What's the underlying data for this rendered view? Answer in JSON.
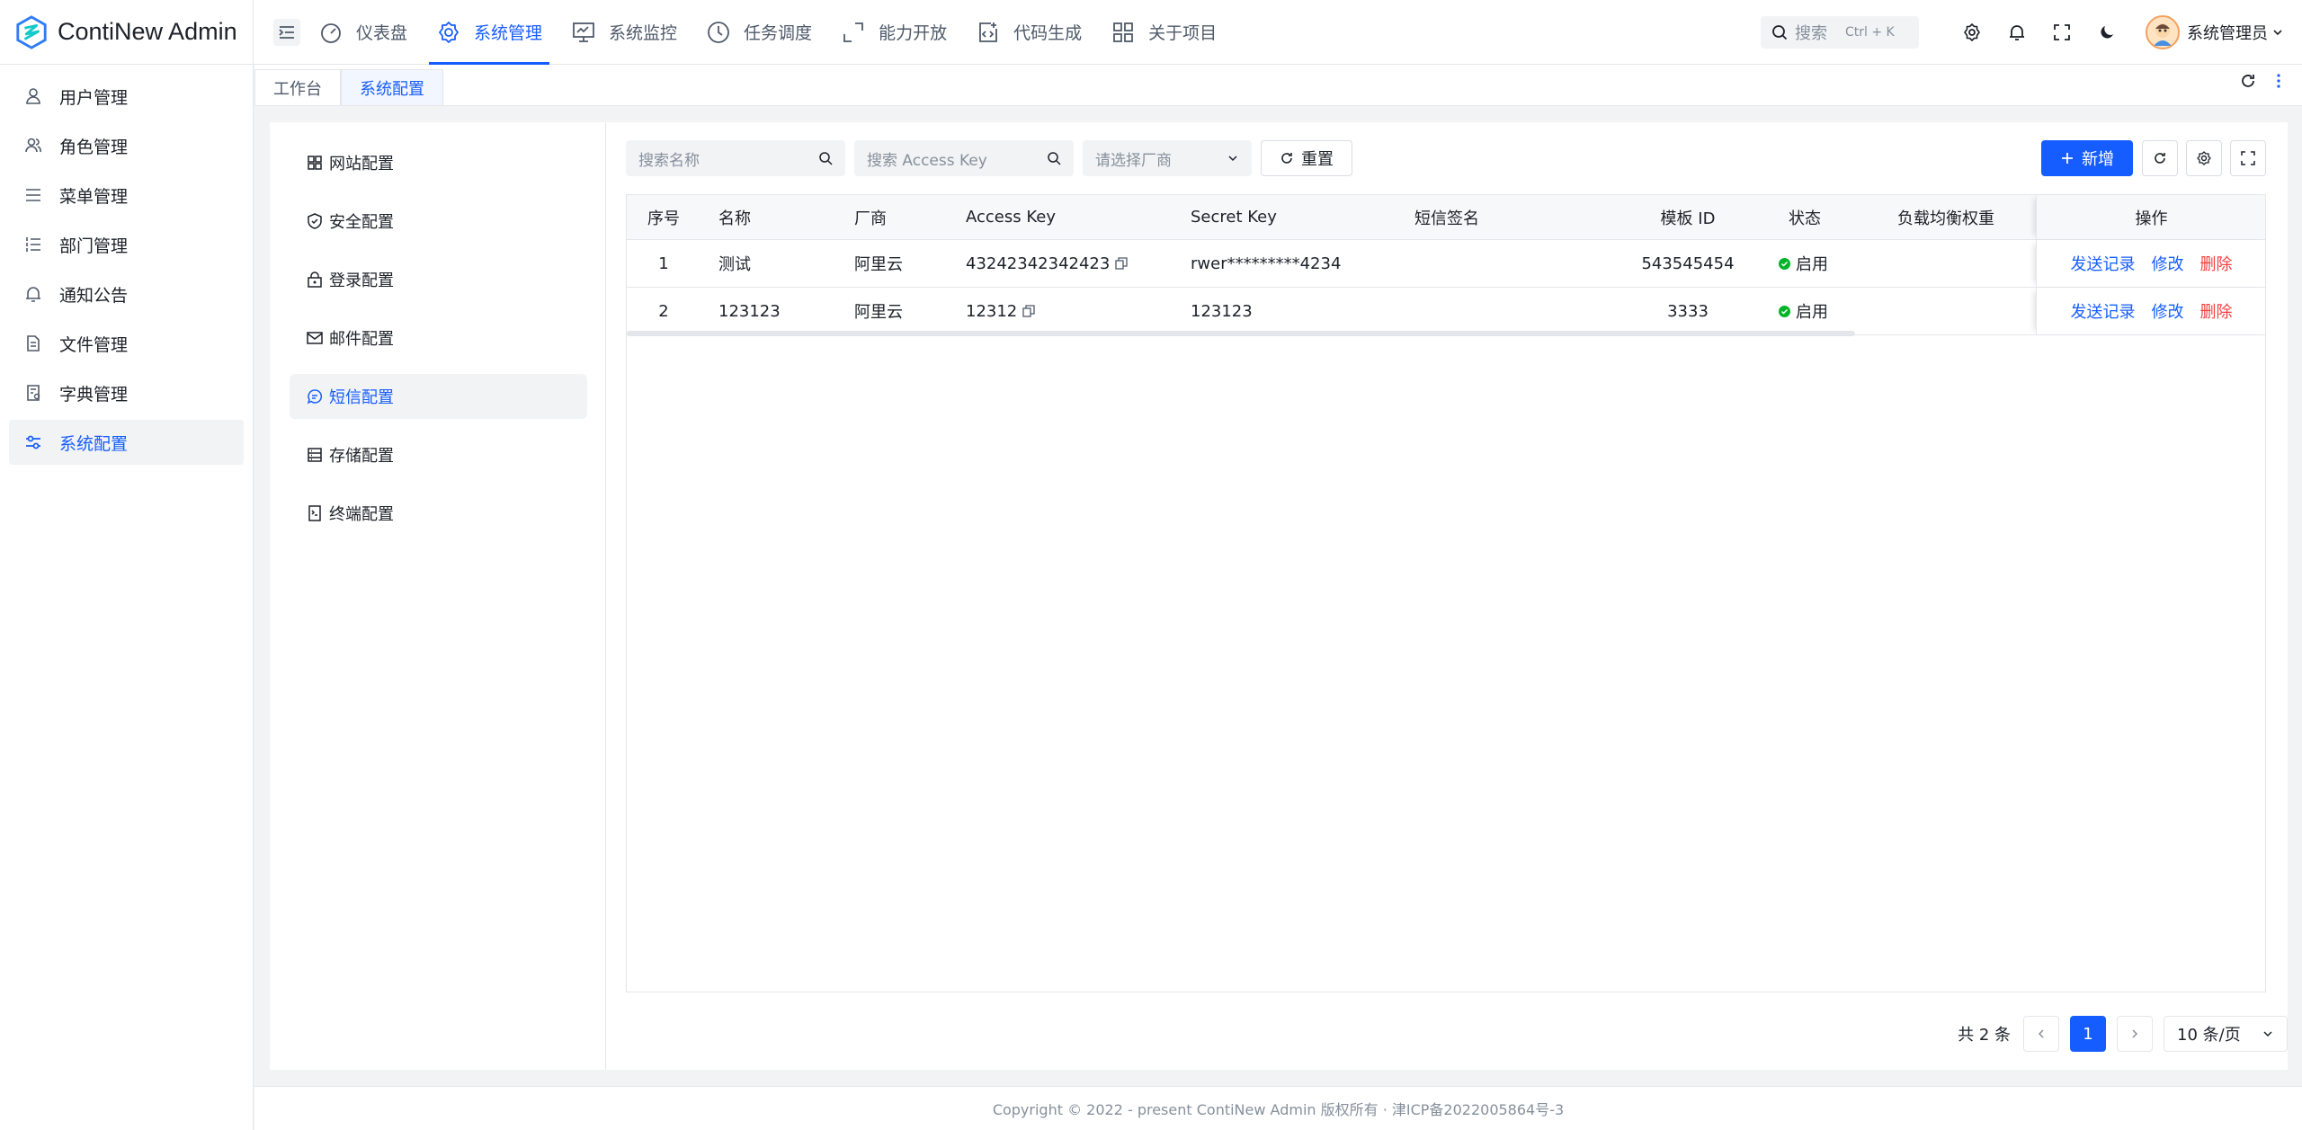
{
  "app": {
    "title": "ContiNew Admin"
  },
  "topnav": [
    {
      "label": "仪表盘",
      "icon": "dashboard-icon"
    },
    {
      "label": "系统管理",
      "icon": "gear-icon",
      "active": true
    },
    {
      "label": "系统监控",
      "icon": "monitor-icon"
    },
    {
      "label": "任务调度",
      "icon": "clock-icon"
    },
    {
      "label": "能力开放",
      "icon": "expand-icon"
    },
    {
      "label": "代码生成",
      "icon": "code-file-icon"
    },
    {
      "label": "关于项目",
      "icon": "grid-icon"
    }
  ],
  "header": {
    "search_placeholder": "搜索",
    "search_shortcut": "Ctrl + K",
    "user_name": "系统管理员"
  },
  "sidebar": [
    {
      "label": "用户管理",
      "icon": "user-icon"
    },
    {
      "label": "角色管理",
      "icon": "users-icon"
    },
    {
      "label": "菜单管理",
      "icon": "menu-list-icon"
    },
    {
      "label": "部门管理",
      "icon": "ordered-list-icon"
    },
    {
      "label": "通知公告",
      "icon": "bell-icon"
    },
    {
      "label": "文件管理",
      "icon": "file-icon"
    },
    {
      "label": "字典管理",
      "icon": "dictionary-icon"
    },
    {
      "label": "系统配置",
      "icon": "sliders-icon",
      "active": true
    }
  ],
  "tabs": [
    {
      "label": "工作台"
    },
    {
      "label": "系统配置",
      "active": true
    }
  ],
  "subnav": [
    {
      "label": "网站配置",
      "icon": "apps-icon"
    },
    {
      "label": "安全配置",
      "icon": "shield-check-icon"
    },
    {
      "label": "登录配置",
      "icon": "lock-icon"
    },
    {
      "label": "邮件配置",
      "icon": "mail-icon"
    },
    {
      "label": "短信配置",
      "icon": "message-icon",
      "active": true
    },
    {
      "label": "存储配置",
      "icon": "storage-icon"
    },
    {
      "label": "终端配置",
      "icon": "terminal-icon"
    }
  ],
  "toolbar": {
    "search_name_placeholder": "搜索名称",
    "search_key_placeholder": "搜索 Access Key",
    "vendor_placeholder": "请选择厂商",
    "reset_label": "重置",
    "add_label": "新增"
  },
  "table": {
    "columns": [
      "序号",
      "名称",
      "厂商",
      "Access Key",
      "Secret Key",
      "短信签名",
      "模板 ID",
      "状态",
      "负载均衡权重",
      "操作"
    ],
    "rows": [
      {
        "index": "1",
        "name": "测试",
        "vendor": "阿里云",
        "access_key": "43242342342423",
        "secret_key": "rwer*********4234",
        "signature": "",
        "template_id": "543545454",
        "status": "启用",
        "weight": ""
      },
      {
        "index": "2",
        "name": "123123",
        "vendor": "阿里云",
        "access_key": "12312",
        "secret_key": "123123",
        "signature": "",
        "template_id": "3333",
        "status": "启用",
        "weight": ""
      }
    ],
    "actions": {
      "records": "发送记录",
      "edit": "修改",
      "delete": "删除"
    }
  },
  "pagination": {
    "total": "共 2 条",
    "current": "1",
    "page_size": "10 条/页"
  },
  "footer": {
    "text": "Copyright © 2022 - present ContiNew Admin 版权所有 · 津ICP备2022005864号-3"
  },
  "colors": {
    "primary": "#165dff",
    "danger": "#f53f3f",
    "success": "#00b42a"
  }
}
